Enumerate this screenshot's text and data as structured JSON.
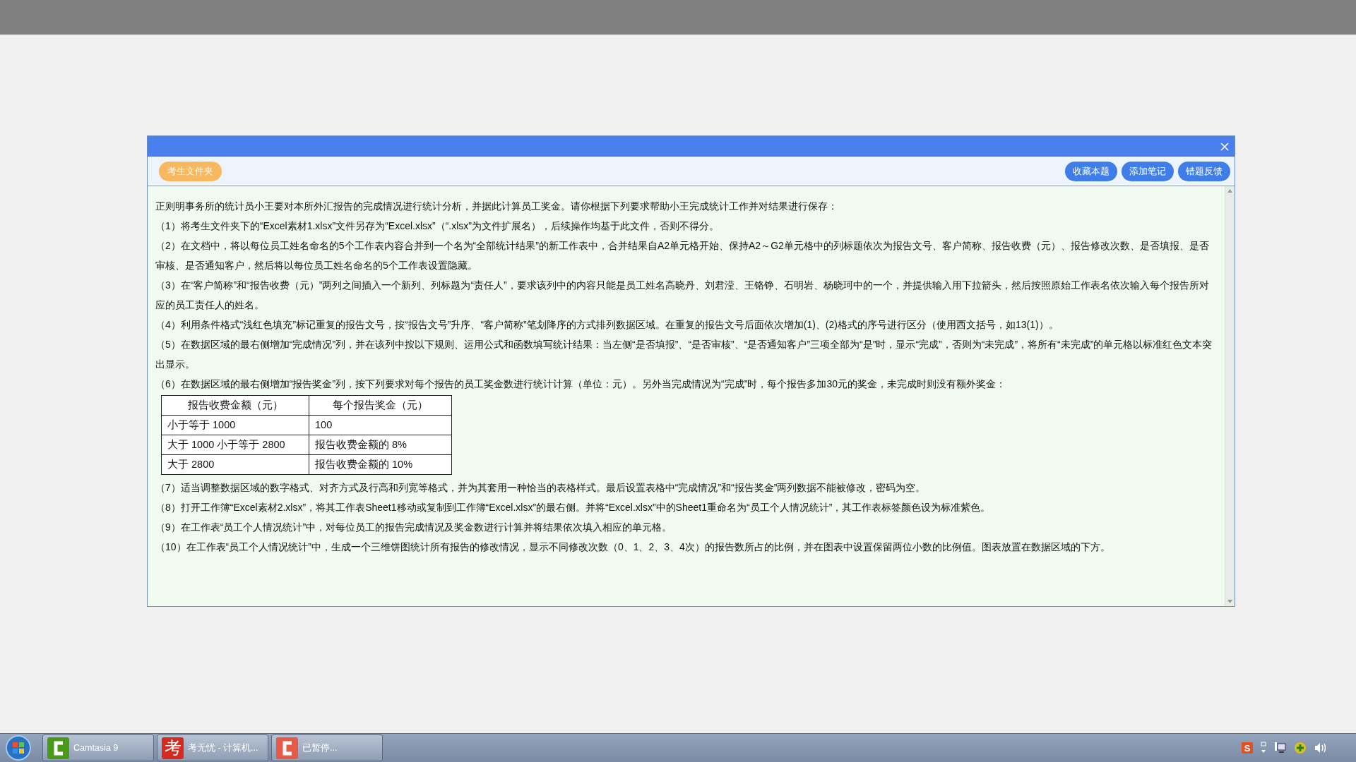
{
  "dialog": {
    "toolbar": {
      "folder_button": "考生文件夹",
      "buttons": [
        "收藏本题",
        "添加笔记",
        "错题反馈"
      ]
    },
    "intro": "正则明事务所的统计员小王要对本所外汇报告的完成情况进行统计分析，并据此计算员工奖金。请你根据下列要求帮助小王完成统计工作并对结果进行保存：",
    "items": [
      {
        "kind": "text",
        "text": "（1）将考生文件夹下的“Excel素材1.xlsx”文件另存为“Excel.xlsx”（“.xlsx”为文件扩展名），后续操作均基于此文件，否则不得分。"
      },
      {
        "kind": "text",
        "text": "（2）在文档中，将以每位员工姓名命名的5个工作表内容合并到一个名为“全部统计结果”的新工作表中，合并结果自A2单元格开始、保持A2～G2单元格中的列标题依次为报告文号、客户简称、报告收费（元）、报告修改次数、是否填报、是否审核、是否通知客户，然后将以每位员工姓名命名的5个工作表设置隐藏。"
      },
      {
        "kind": "text",
        "text": "（3）在“客户简称”和“报告收费（元）”两列之间插入一个新列、列标题为“责任人”，要求该列中的内容只能是员工姓名高晓丹、刘君滢、王铬铮、石明岩、杨晓珂中的一个，并提供输入用下拉箭头，然后按照原始工作表名依次输入每个报告所对应的员工责任人的姓名。"
      },
      {
        "kind": "text",
        "text": "（4）利用条件格式“浅红色填充”标记重复的报告文号，按“报告文号”升序、“客户简称”笔划降序的方式排列数据区域。在重复的报告文号后面依次增加(1)、(2)格式的序号进行区分（使用西文括号，如13(1)）。"
      },
      {
        "kind": "text",
        "text": "（5）在数据区域的最右侧增加“完成情况”列，并在该列中按以下规则、运用公式和函数填写统计结果：当左侧“是否填报”、“是否审核”、“是否通知客户”三项全部为“是”时，显示“完成”，否则为“未完成”，将所有“未完成”的单元格以标准红色文本突出显示。"
      },
      {
        "kind": "text",
        "text": "（6）在数据区域的最右侧增加“报告奖金”列，按下列要求对每个报告的员工奖金数进行统计计算（单位：元）。另外当完成情况为“完成”时，每个报告多加30元的奖金，未完成时则没有额外奖金："
      },
      {
        "kind": "table",
        "columns": [
          "报告收费金额（元）",
          "每个报告奖金（元）"
        ],
        "rows": [
          [
            "小于等于 1000",
            "100"
          ],
          [
            "大于 1000 小于等于 2800",
            "报告收费金额的 8%"
          ],
          [
            "大于 2800",
            "报告收费金额的 10%"
          ]
        ]
      },
      {
        "kind": "text",
        "text": "（7）适当调整数据区域的数字格式、对齐方式及行高和列宽等格式，并为其套用一种恰当的表格样式。最后设置表格中“完成情况”和“报告奖金”两列数据不能被修改，密码为空。"
      },
      {
        "kind": "text",
        "text": "（8）打开工作簿“Excel素材2.xlsx”，将其工作表Sheet1移动或复制到工作簿“Excel.xlsx”的最右侧。并将“Excel.xlsx”中的Sheet1重命名为“员工个人情况统计”，其工作表标签颜色设为标准紫色。"
      },
      {
        "kind": "text",
        "text": "（9）在工作表“员工个人情况统计”中，对每位员工的报告完成情况及奖金数进行计算并将结果依次填入相应的单元格。"
      },
      {
        "kind": "text",
        "text": "（10）在工作表“员工个人情况统计”中，生成一个三维饼图统计所有报告的修改情况，显示不同修改次数（0、1、2、3、4次）的报告数所占的比例，并在图表中设置保留两位小数的比例值。图表放置在数据区域的下方。"
      }
    ]
  },
  "taskbar": {
    "items": [
      {
        "kind": "green-c",
        "label": "Camtasia 9"
      },
      {
        "kind": "glyph",
        "glyph": "考",
        "label": "考无忧 - 计算机..."
      },
      {
        "kind": "red-c",
        "label": "已暂停..."
      }
    ],
    "tray": {
      "ime_glyph": "S"
    }
  }
}
